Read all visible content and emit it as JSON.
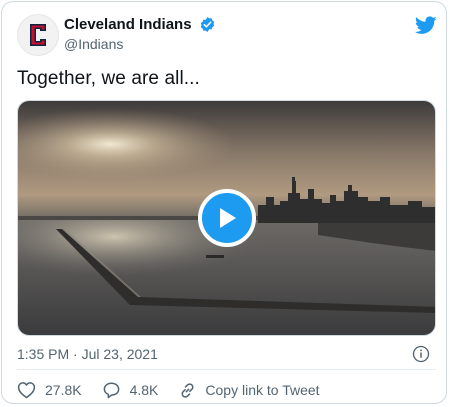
{
  "author": {
    "display_name": "Cleveland Indians",
    "handle": "@Indians",
    "verified": true,
    "avatar_icon": "cleveland-c-logo-icon",
    "avatar_letter": "C"
  },
  "platform_icon": "twitter-bird-icon",
  "tweet": {
    "text": "Together, we are all...",
    "timestamp": "1:35 PM · Jul 23, 2021"
  },
  "media": {
    "type": "video",
    "play_icon": "play-icon"
  },
  "actions": {
    "like_count": "27.8K",
    "reply_count": "4.8K",
    "copy_link_label": "Copy link to Tweet"
  },
  "colors": {
    "accent": "#1d9bf0",
    "text_primary": "#0f1419",
    "text_secondary": "#536471",
    "brand_red": "#c8102e",
    "brand_navy": "#0c2340"
  }
}
